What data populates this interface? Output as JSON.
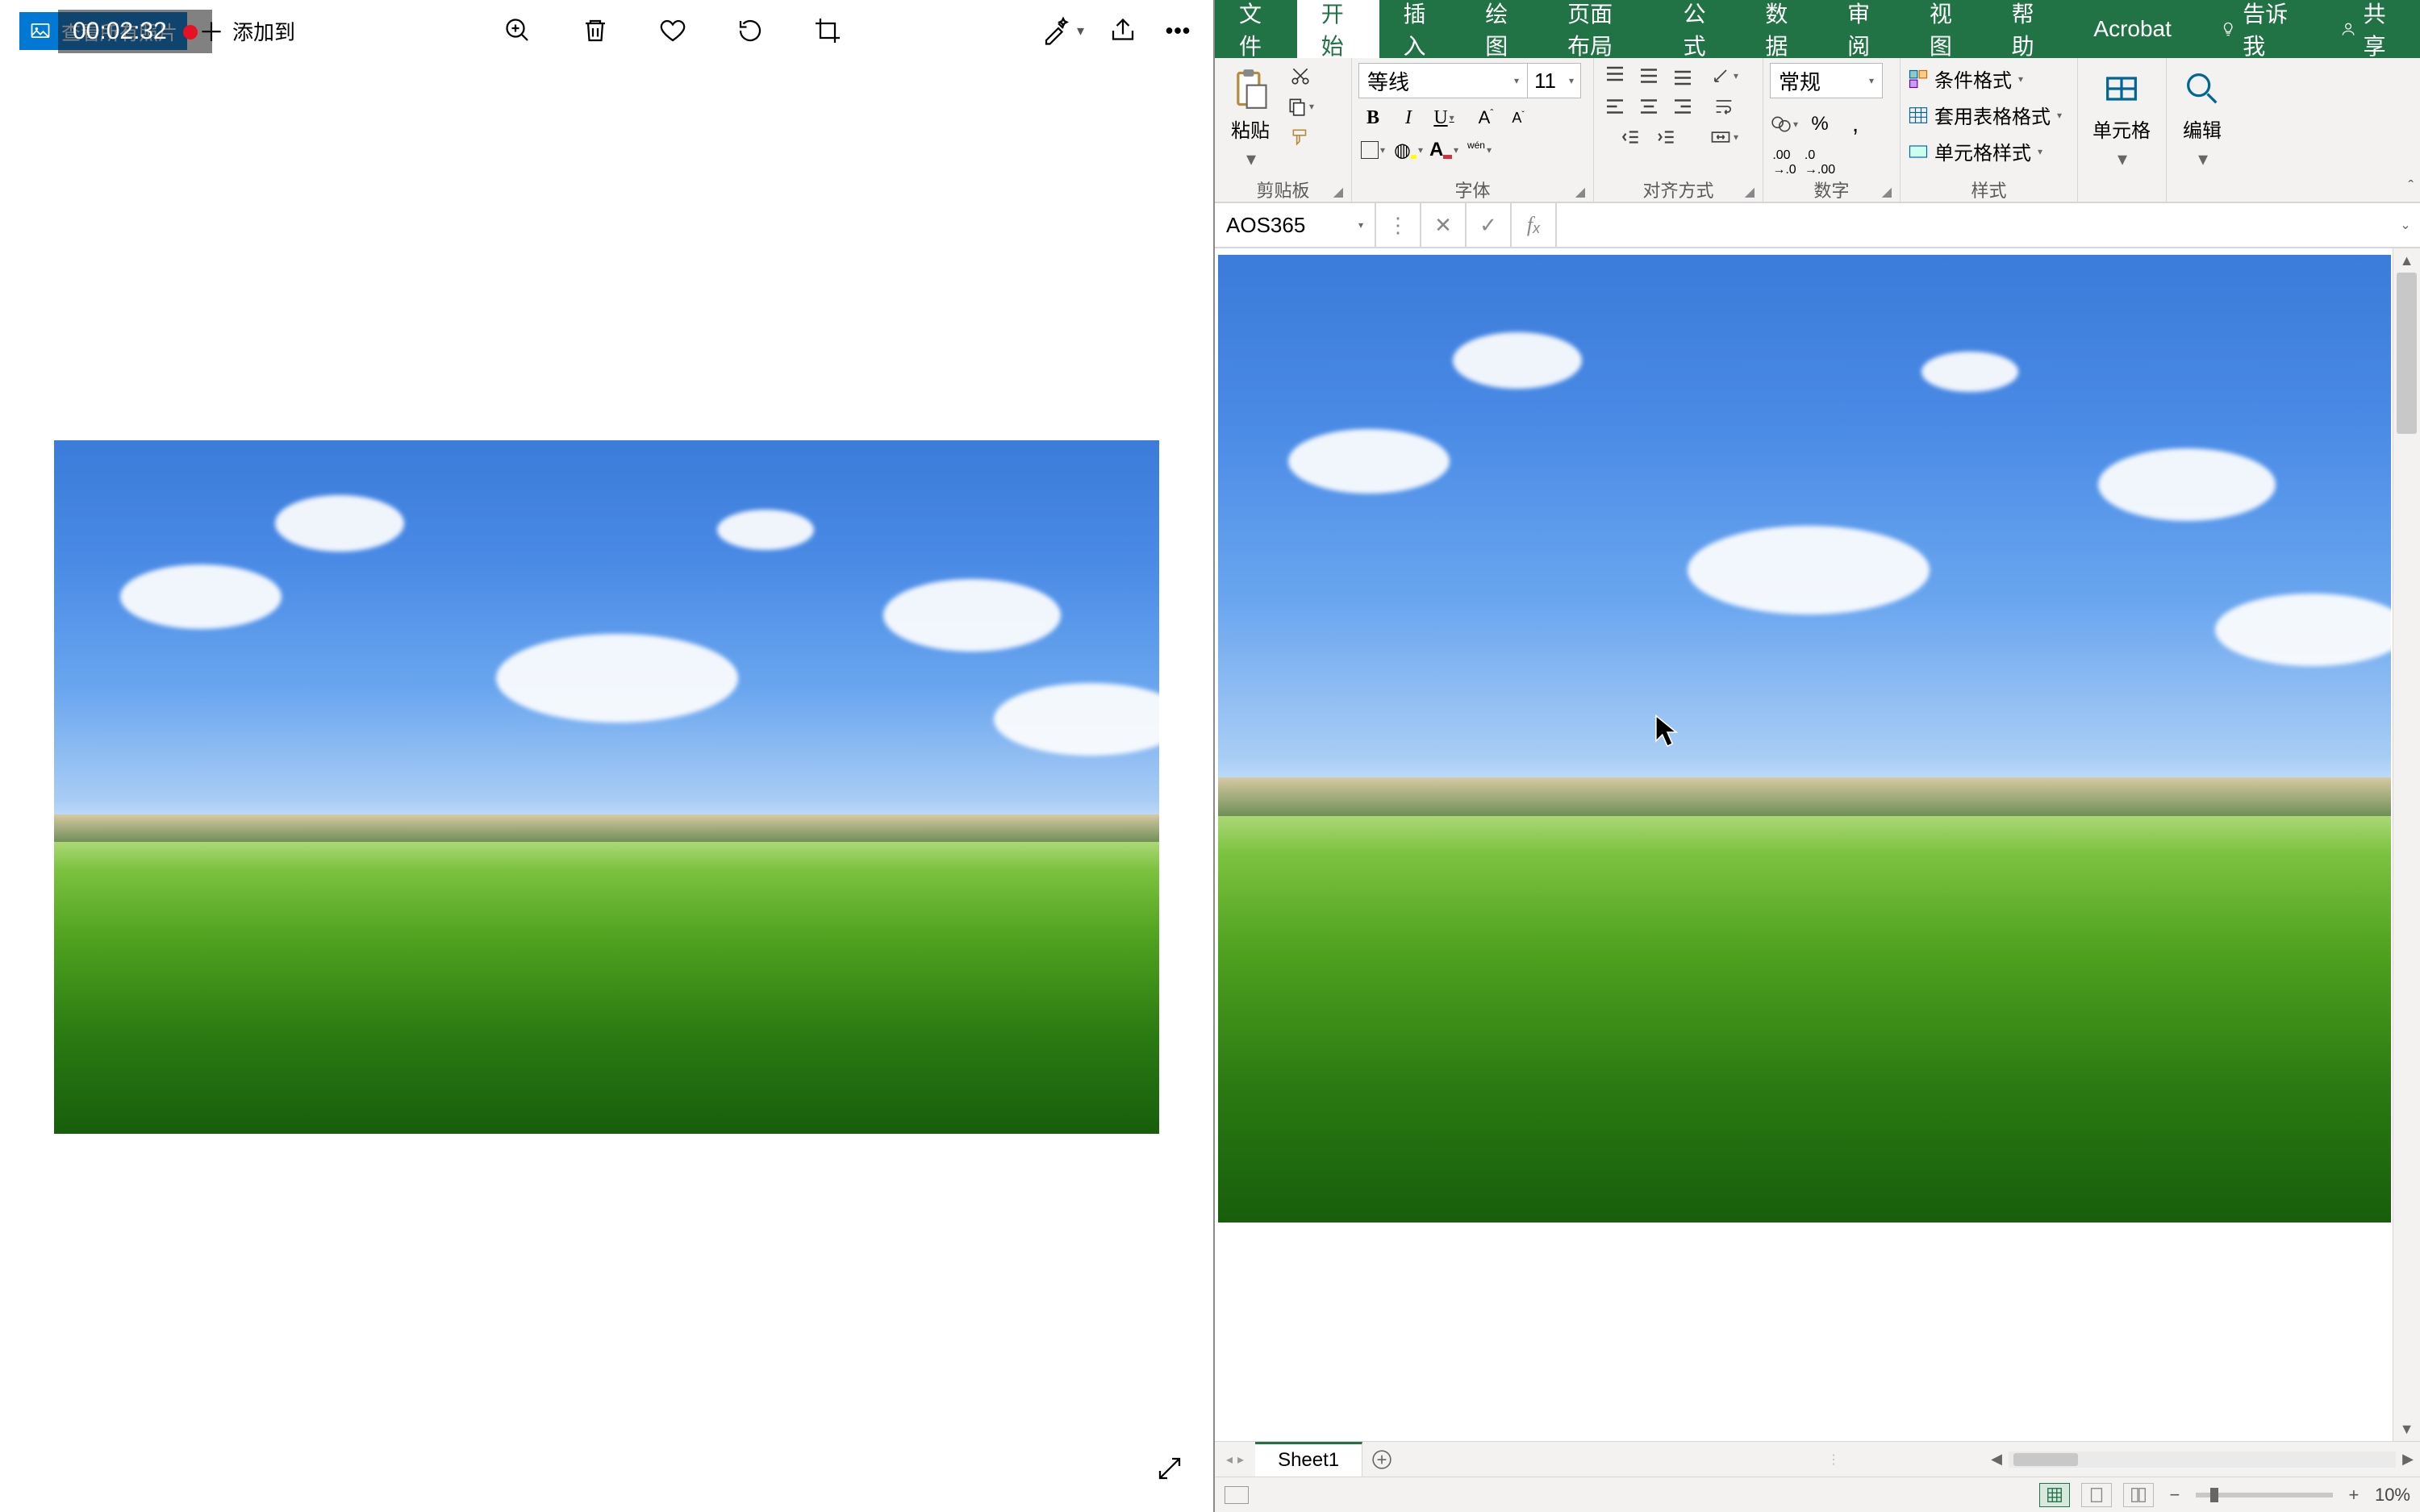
{
  "photos": {
    "view_all": "查看所有照片",
    "timer": "00:02:32",
    "add_to": "添加到",
    "icons": {
      "zoom": "zoom-icon",
      "delete": "delete-icon",
      "favorite": "favorite-icon",
      "rotate": "rotate-icon",
      "crop": "crop-icon",
      "edit": "edit-icon",
      "share": "share-icon",
      "more": "more-icon",
      "expand": "expand-icon"
    }
  },
  "excel": {
    "tabs": {
      "file": "文件",
      "home": "开始",
      "insert": "插入",
      "draw": "绘图",
      "layout": "页面布局",
      "formulas": "公式",
      "data": "数据",
      "review": "审阅",
      "view": "视图",
      "help": "帮助",
      "acrobat": "Acrobat",
      "tell_me": "告诉我",
      "share": "共享"
    },
    "ribbon": {
      "clipboard": {
        "label": "剪贴板",
        "paste": "粘贴"
      },
      "font": {
        "label": "字体",
        "name": "等线",
        "size": "11",
        "wen": "wén"
      },
      "align": {
        "label": "对齐方式"
      },
      "number": {
        "label": "数字",
        "format": "常规"
      },
      "styles": {
        "label": "样式",
        "cond": "条件格式",
        "table": "套用表格格式",
        "cell": "单元格样式"
      },
      "cells": {
        "label": "单元格"
      },
      "editing": {
        "label": "编辑"
      }
    },
    "namebox": "AOS365",
    "sheet_tab": "Sheet1",
    "zoom": "10%"
  }
}
